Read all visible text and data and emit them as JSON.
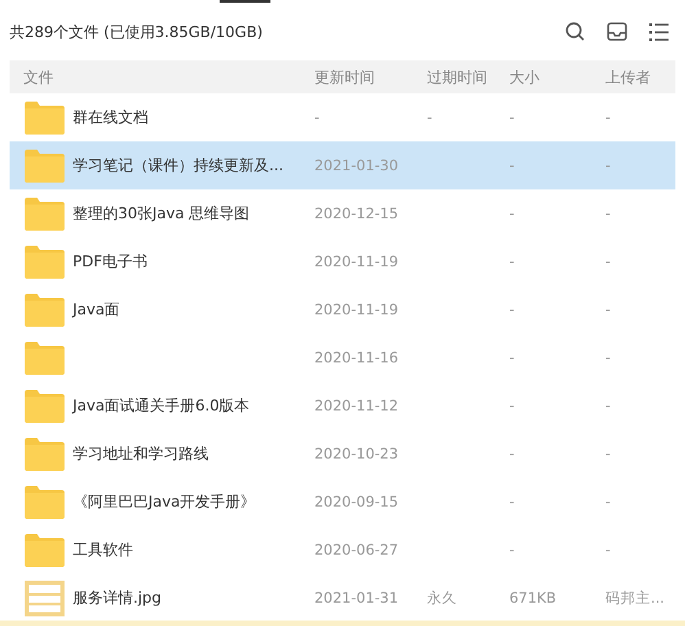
{
  "summary": "共289个文件 (已使用3.85GB/10GB)",
  "columns": [
    "文件",
    "更新时间",
    "过期时间",
    "大小",
    "上传者"
  ],
  "rows": [
    {
      "kind": "folder",
      "name": "群在线文档",
      "updated": "-",
      "expires": "-",
      "size": "-",
      "uploader": "-",
      "selected": false
    },
    {
      "kind": "folder",
      "name": "学习笔记（课件）持续更新及...",
      "updated": "2021-01-30",
      "size": "-",
      "uploader": "-",
      "selected": true
    },
    {
      "kind": "folder",
      "name": "整理的30张Java 思维导图",
      "updated": "2020-12-15",
      "size": "-",
      "uploader": "-",
      "selected": false
    },
    {
      "kind": "folder",
      "name": "PDF电子书",
      "updated": "2020-11-19",
      "size": "-",
      "uploader": "-",
      "selected": false
    },
    {
      "kind": "folder",
      "name": "Java面",
      "updated": "2020-11-19",
      "size": "-",
      "uploader": "-",
      "selected": false
    },
    {
      "kind": "folder",
      "updated": "2020-11-16",
      "size": "-",
      "uploader": "-",
      "selected": false
    },
    {
      "kind": "folder",
      "name": "Java面试通关手册6.0版本",
      "updated": "2020-11-12",
      "size": "-",
      "uploader": "-",
      "selected": false
    },
    {
      "kind": "folder",
      "name": "学习地址和学习路线",
      "updated": "2020-10-23",
      "size": "-",
      "uploader": "-",
      "selected": false
    },
    {
      "kind": "folder",
      "name": "《阿里巴巴Java开发手册》",
      "updated": "2020-09-15",
      "size": "-",
      "uploader": "-",
      "selected": false
    },
    {
      "kind": "folder",
      "name": "工具软件",
      "updated": "2020-06-27",
      "size": "-",
      "uploader": "-",
      "selected": false
    },
    {
      "kind": "image",
      "name": "服务详情.jpg",
      "updated": "2021-01-31",
      "expires": "永久",
      "size": "671KB",
      "uploader": "码邦主...",
      "selected": false
    }
  ]
}
